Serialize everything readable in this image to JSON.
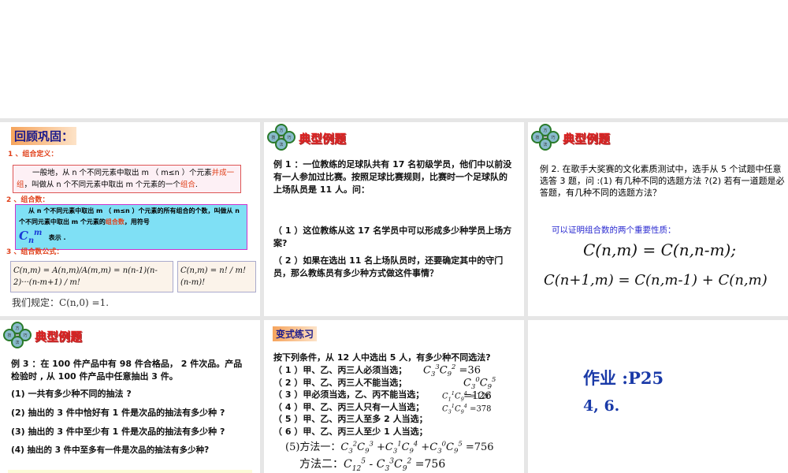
{
  "slide1": {
    "title": "回顾巩固：",
    "h1": "1 、组合定义：",
    "def_a": "一般地，从 n 个不同元素中取出 m （ m≤n ）个元素",
    "def_red1": "并成一组",
    "def_b": "，叫做从 n 个不同元素中取出 m 个元素的一个",
    "def_red2": "组合",
    "def_end": ".",
    "h2": "2 、组合数：",
    "num_a": "从 n 个不同元素中取出 m （ m≤n ）个元素的所有组合的个数，叫做从 n 个不同元素中取出 m 个元素的",
    "num_red": "组合数",
    "num_b": "，用符号",
    "num_c": "表示 .",
    "h3": "3 、组合数公式：",
    "formula1": "C(n,m) = A(n,m)/A(m,m) = n(n-1)(n-2)···(n-m+1) / m!",
    "formula2": "C(n,m) = n! / m!(n-m)!",
    "rule": "我们规定：C(n,0) =1."
  },
  "logo": {
    "chars": [
      "方",
      "技",
      "巧",
      "法",
      "与"
    ],
    "title": "典型例题"
  },
  "slide2": {
    "p": "例 1 ：一位教练的足球队共有 17 名初级学员，他们中以前没有一人参加过比赛。按照足球比赛规则，比赛时一个足球队的上场队员是 11 人。问：",
    "q1": "（ 1 ）这位教练从这 17 名学员中可以形成多少种学员上场方案?",
    "q2": "（ 2 ）如果在选出 11 名上场队员时，还要确定其中的守门员，那么教练员有多少种方式做这件事情？"
  },
  "slide3": {
    "p": "例 2. 在歌手大奖赛的文化素质测试中，选手从 5 个试题中任意选答 3 题，问 :(1) 有几种不同的选题方法 ?(2) 若有一道题是必答题，有几种不同的选题方法？",
    "prop": "可以证明组合数的两个重要性质：",
    "f1": "C(n,m) = C(n,n-m);",
    "f2": "C(n+1,m) = C(n,m-1) + C(n,m)"
  },
  "slide4": {
    "p": "例 3 ：在 100 件产品中有 98 件合格品， 2 件次品。产品检验时 , 从 100 件产品中任意抽出 3 件。",
    "q": [
      "(1) 一共有多少种不同的抽法 ?",
      "(2) 抽出的 3 件中恰好有 1 件是次品的抽法有多少种 ?",
      "(3) 抽出的 3 件中至少有 1 件是次品的抽法有多少种 ?",
      "(4) 抽出的 3 件中至多有一件是次品的抽法有多少种?"
    ]
  },
  "slide5": {
    "title": "变式练习",
    "p": "按下列条件，从 12 人中选出 5 人，有多少种不同选法?",
    "q": [
      "（ 1 ）甲、乙、丙三人必须当选；",
      "（ 2 ）甲、乙、丙三人不能当选；",
      "（ 3 ）甲必须当选，乙、丙不能当选；",
      "（ 4 ）甲、乙、丙三人只有一人当选；",
      "（ 5 ）甲、乙、丙三人至多 2 人当选；",
      "（ 6 ）甲、乙、丙三人至少 1 人当选；"
    ],
    "a": [
      "=36",
      "=126",
      "=126",
      "=378"
    ],
    "m1_label": "(5)方法一：",
    "m1": "=756",
    "m2_label": "方法二：",
    "m2": "=756"
  },
  "slide6": {
    "hw": "作业 :P25",
    "hw2": "4, 6."
  }
}
